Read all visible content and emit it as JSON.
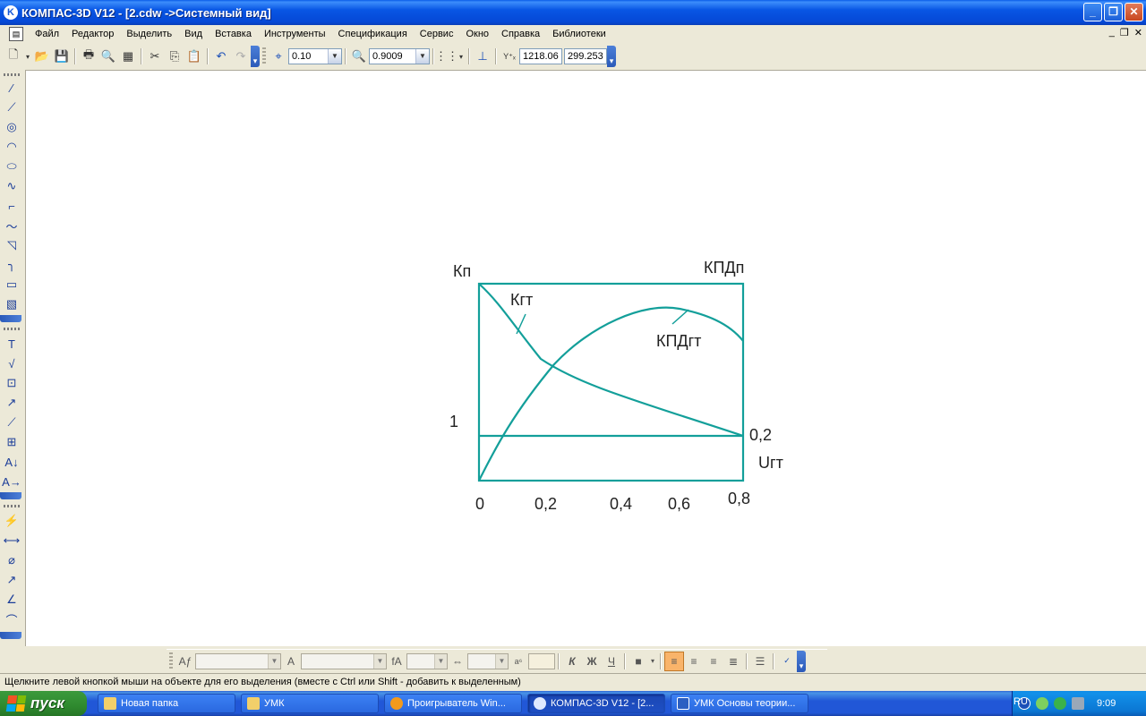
{
  "window": {
    "title": "КОМПАС-3D V12 - [2.cdw ->Системный вид]",
    "app_icon": "K"
  },
  "menu": {
    "items": [
      "Файл",
      "Редактор",
      "Выделить",
      "Вид",
      "Вставка",
      "Инструменты",
      "Спецификация",
      "Сервис",
      "Окно",
      "Справка",
      "Библиотеки"
    ]
  },
  "toolbar": {
    "step": "0.10",
    "zoom": "0.9009",
    "coord_x": "1218.06",
    "coord_y": "299.253"
  },
  "drawing": {
    "label_kp": "Кп",
    "label_kpd_p": "КПДп",
    "label_kgt": "Кгт",
    "label_kpd_gt": "КПДгт",
    "label_one": "1",
    "label_02_right": "0,2",
    "label_ugt": "Uгт",
    "x_ticks": [
      "0",
      "0,2",
      "0,4",
      "0,6",
      "0,8"
    ],
    "line_color": "#139f9a"
  },
  "statusbar": {
    "text": "Щелкните левой кнопкой мыши на объекте для его выделения (вместе с Ctrl или Shift - добавить к выделенным)"
  },
  "taskbar": {
    "start_label": "пуск",
    "tasks": [
      {
        "label": "Новая папка",
        "icon": "folder-icon"
      },
      {
        "label": "УМК",
        "icon": "folder-icon"
      },
      {
        "label": "Проигрыватель Win...",
        "icon": "media-player-icon"
      },
      {
        "label": "КОМПАС-3D V12 - [2...",
        "icon": "kompas-icon"
      },
      {
        "label": "УМК Основы теории...",
        "icon": "word-icon"
      }
    ],
    "lang": "RU",
    "clock": "9:09"
  }
}
